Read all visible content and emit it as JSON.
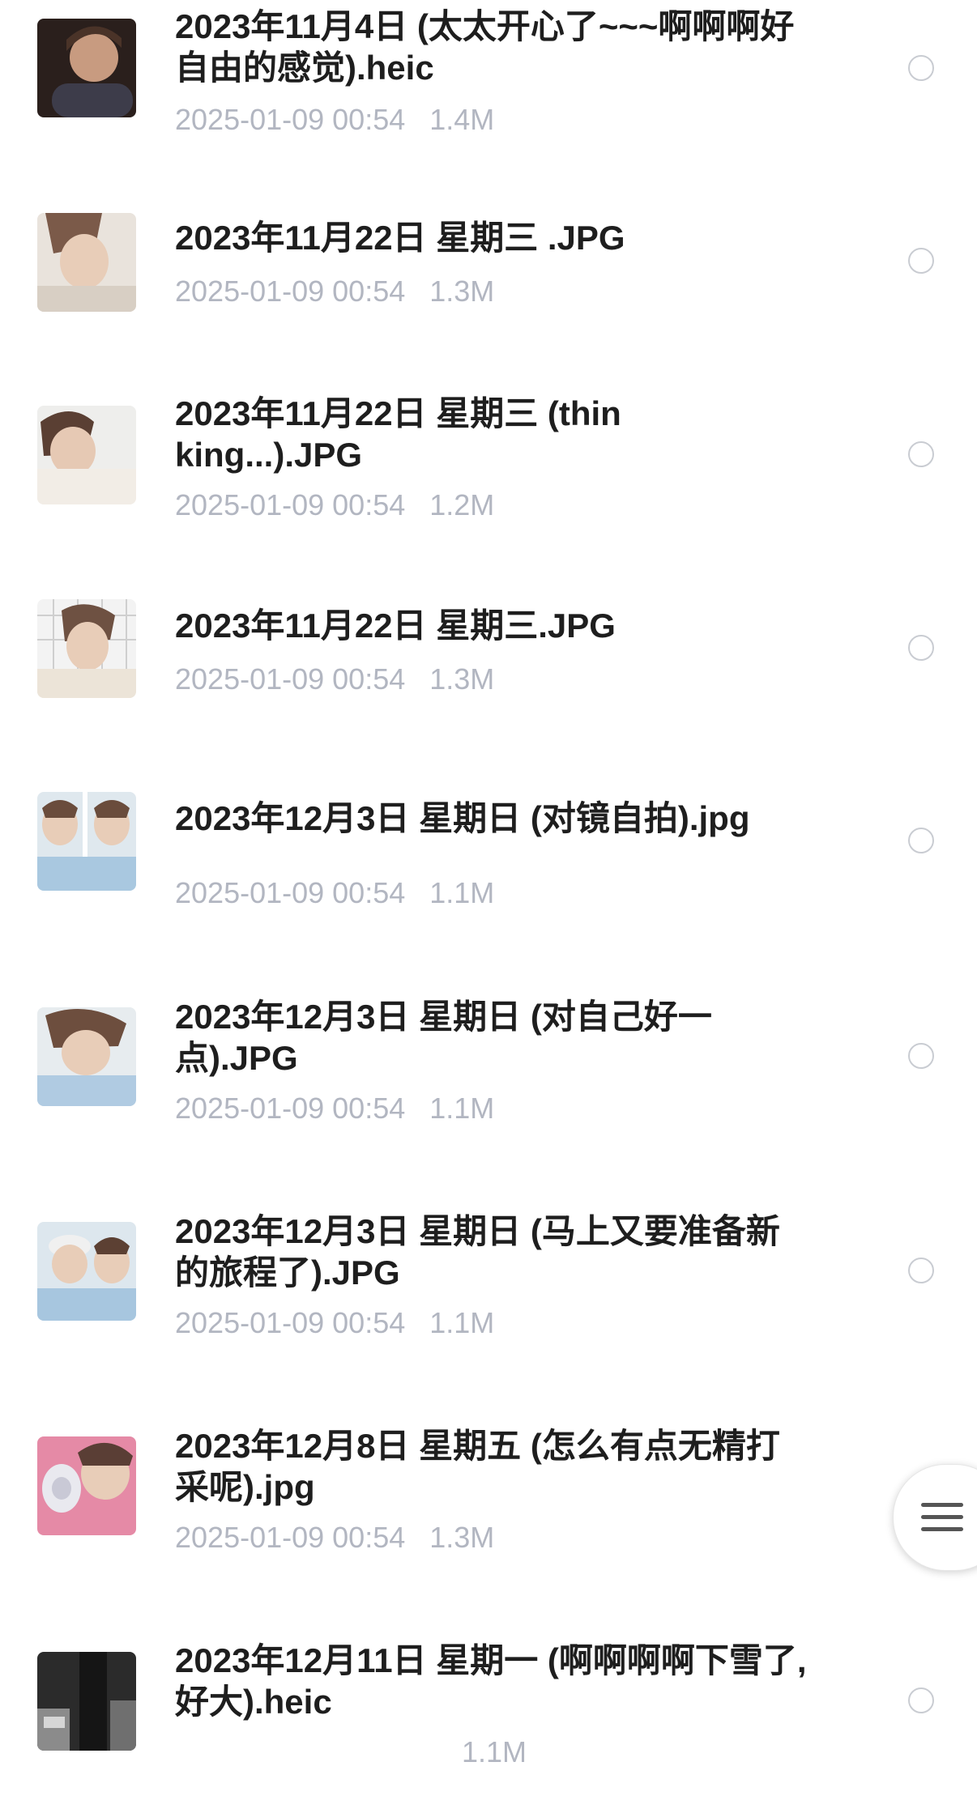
{
  "files": [
    {
      "name": "2023年11月4日 (太太开心了~~~啊啊啊好自由的感觉).heic",
      "date": "2025-01-09 00:54",
      "size": "1.4M",
      "thumb_icon": "photo-thumbnail-icon",
      "thumb_colors": [
        "#2a1f1c",
        "#6b4a3a",
        "#c89b80"
      ]
    },
    {
      "name": "2023年11月22日 星期三 .JPG",
      "date": "2025-01-09 00:54",
      "size": "1.3M",
      "thumb_icon": "photo-thumbnail-icon",
      "thumb_colors": [
        "#e9e3dc",
        "#7b5a49",
        "#d8cfc4"
      ]
    },
    {
      "name": "2023年11月22日 星期三 (thinking...).JPG",
      "date": "2025-01-09 00:54",
      "size": "1.2M",
      "thumb_icon": "photo-thumbnail-icon",
      "thumb_colors": [
        "#eeeeec",
        "#5a3f33",
        "#f2ede6"
      ]
    },
    {
      "name": "2023年11月22日 星期三.JPG",
      "date": "2025-01-09 00:54",
      "size": "1.3M",
      "thumb_icon": "photo-thumbnail-icon",
      "thumb_colors": [
        "#f3f3f3",
        "#6e5142",
        "#ece4d8"
      ]
    },
    {
      "name": "2023年12月3日 星期日 (对镜自拍).jpg",
      "date": "2025-01-09 00:54",
      "size": "1.1M",
      "thumb_icon": "photo-thumbnail-icon",
      "thumb_colors": [
        "#dfe8ee",
        "#6a4c3c",
        "#a9c8e0"
      ]
    },
    {
      "name": "2023年12月3日 星期日 (对自己好一点).JPG",
      "date": "2025-01-09 00:54",
      "size": "1.1M",
      "thumb_icon": "photo-thumbnail-icon",
      "thumb_colors": [
        "#e7ecef",
        "#6d4e3e",
        "#b0cbe2"
      ]
    },
    {
      "name": "2023年12月3日 星期日 (马上又要准备新的旅程了).JPG",
      "date": "2025-01-09 00:54",
      "size": "1.1M",
      "thumb_icon": "photo-thumbnail-icon",
      "thumb_colors": [
        "#dde7ee",
        "#f0f0f0",
        "#a7c6df"
      ]
    },
    {
      "name": "2023年12月8日 星期五 (怎么有点无精打采呢).jpg",
      "date": "2025-01-09 00:54",
      "size": "1.3M",
      "thumb_icon": "photo-thumbnail-icon",
      "thumb_colors": [
        "#e58aa6",
        "#e9e9ef",
        "#5a3e35"
      ]
    },
    {
      "name": "2023年12月11日 星期一 (啊啊啊啊下雪了,好大).heic",
      "date": "",
      "size": "1.1M",
      "thumb_icon": "photo-thumbnail-icon",
      "thumb_colors": [
        "#2b2b2b",
        "#8b8b8b",
        "#d6d6d6"
      ]
    }
  ],
  "menu_button": {
    "icon": "menu-icon"
  }
}
